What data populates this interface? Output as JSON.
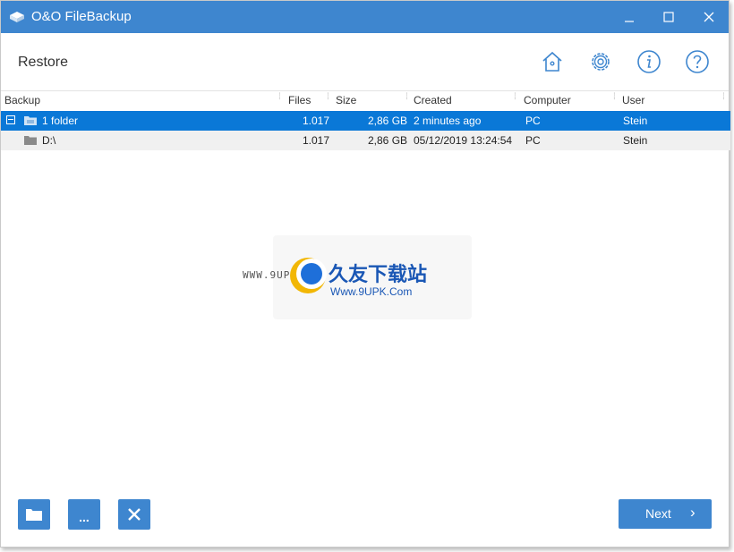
{
  "window": {
    "title": "O&O FileBackup"
  },
  "header": {
    "title": "Restore"
  },
  "grid": {
    "columns": [
      "Backup",
      "Files",
      "Size",
      "Created",
      "Computer",
      "User"
    ],
    "rows": [
      {
        "name": "1 folder",
        "files": "1.017",
        "size": "2,86 GB",
        "created": "2 minutes ago",
        "computer": "PC",
        "user": "Stein"
      },
      {
        "name": "D:\\",
        "files": "1.017",
        "size": "2,86 GB",
        "created": "05/12/2019 13:24:54",
        "computer": "PC",
        "user": "Stein"
      }
    ]
  },
  "footer": {
    "more_label": "...",
    "next_label": "Next",
    "next_chevron": "›"
  },
  "watermark": {
    "left_text": "WWW.9UPK.COM",
    "cn_text": "久友下载站",
    "url_text": "Www.9UPK.Com"
  },
  "colors": {
    "accent": "#3e86cf",
    "selection": "#0a78d7"
  },
  "icons": [
    "app-drive-icon",
    "minimize-icon",
    "maximize-icon",
    "close-icon",
    "home-icon",
    "settings-icon",
    "info-icon",
    "help-icon",
    "folder-icon",
    "delete-icon"
  ]
}
